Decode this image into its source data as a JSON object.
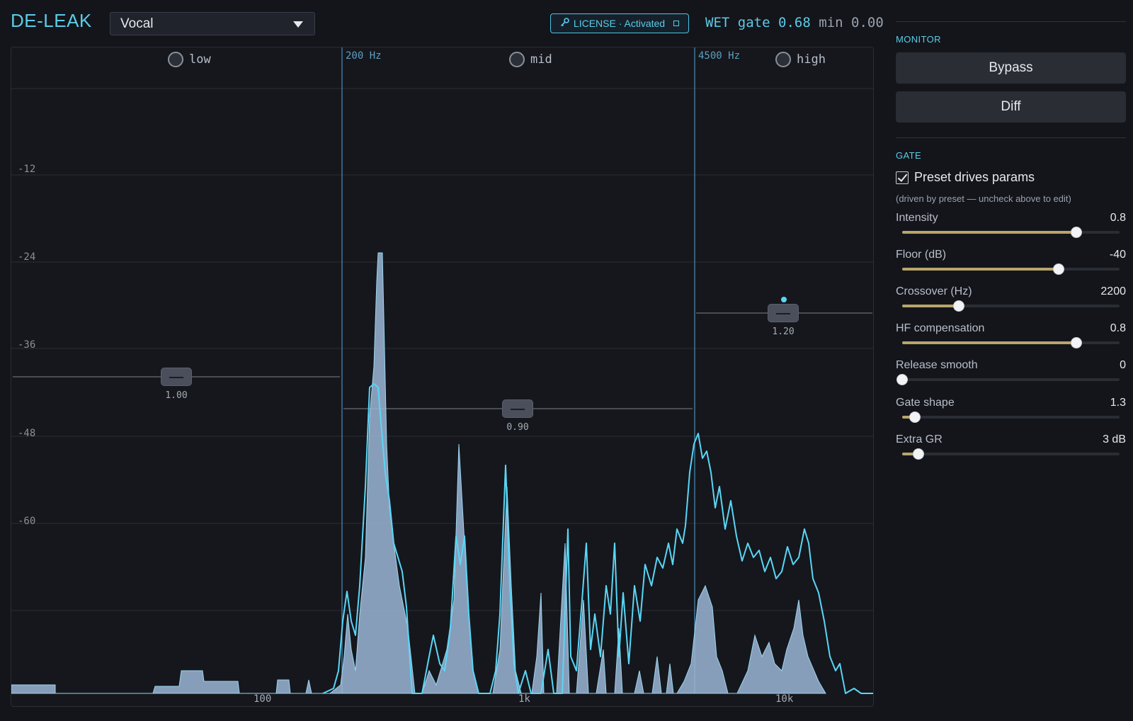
{
  "header": {
    "title": "DE-LEAK",
    "preset_value": "Vocal",
    "license_text": "LICENSE · Activated",
    "wet_label": "WET",
    "gate_label": "gate",
    "gate_value": "0.68",
    "min_label": "min",
    "min_value": "0.00"
  },
  "analyzer": {
    "bands": [
      {
        "name": "low",
        "gain": "1.00"
      },
      {
        "name": "mid",
        "gain": "0.90"
      },
      {
        "name": "high",
        "gain": "1.20"
      }
    ],
    "crossovers": [
      "200 Hz",
      "4500 Hz"
    ],
    "db_ticks": [
      "-12",
      "-24",
      "-36",
      "-48",
      "-60"
    ],
    "freq_ticks": [
      "100",
      "1k",
      "10k"
    ],
    "colors": {
      "spectrum_fill": "#9bb6d6",
      "spectrum_line": "#5ad6f5",
      "crossover_line": "#4a8fb8",
      "grid": "#2a2d34"
    }
  },
  "monitor": {
    "title": "MONITOR",
    "bypass_label": "Bypass",
    "diff_label": "Diff"
  },
  "gate": {
    "title": "GATE",
    "preset_drives_label": "Preset drives params",
    "preset_drives_checked": true,
    "hint": "(driven by preset — uncheck above to edit)",
    "params": [
      {
        "name": "Intensity",
        "value": "0.8",
        "fraction": 0.8
      },
      {
        "name": "Floor (dB)",
        "value": "-40",
        "fraction": 0.72
      },
      {
        "name": "Crossover (Hz)",
        "value": "2200",
        "fraction": 0.26
      },
      {
        "name": "HF compensation",
        "value": "0.8",
        "fraction": 0.8
      },
      {
        "name": "Release smooth",
        "value": "0",
        "fraction": 0.0
      },
      {
        "name": "Gate shape",
        "value": "1.3",
        "fraction": 0.06
      },
      {
        "name": "Extra GR",
        "value": "3 dB",
        "fraction": 0.075
      }
    ]
  }
}
